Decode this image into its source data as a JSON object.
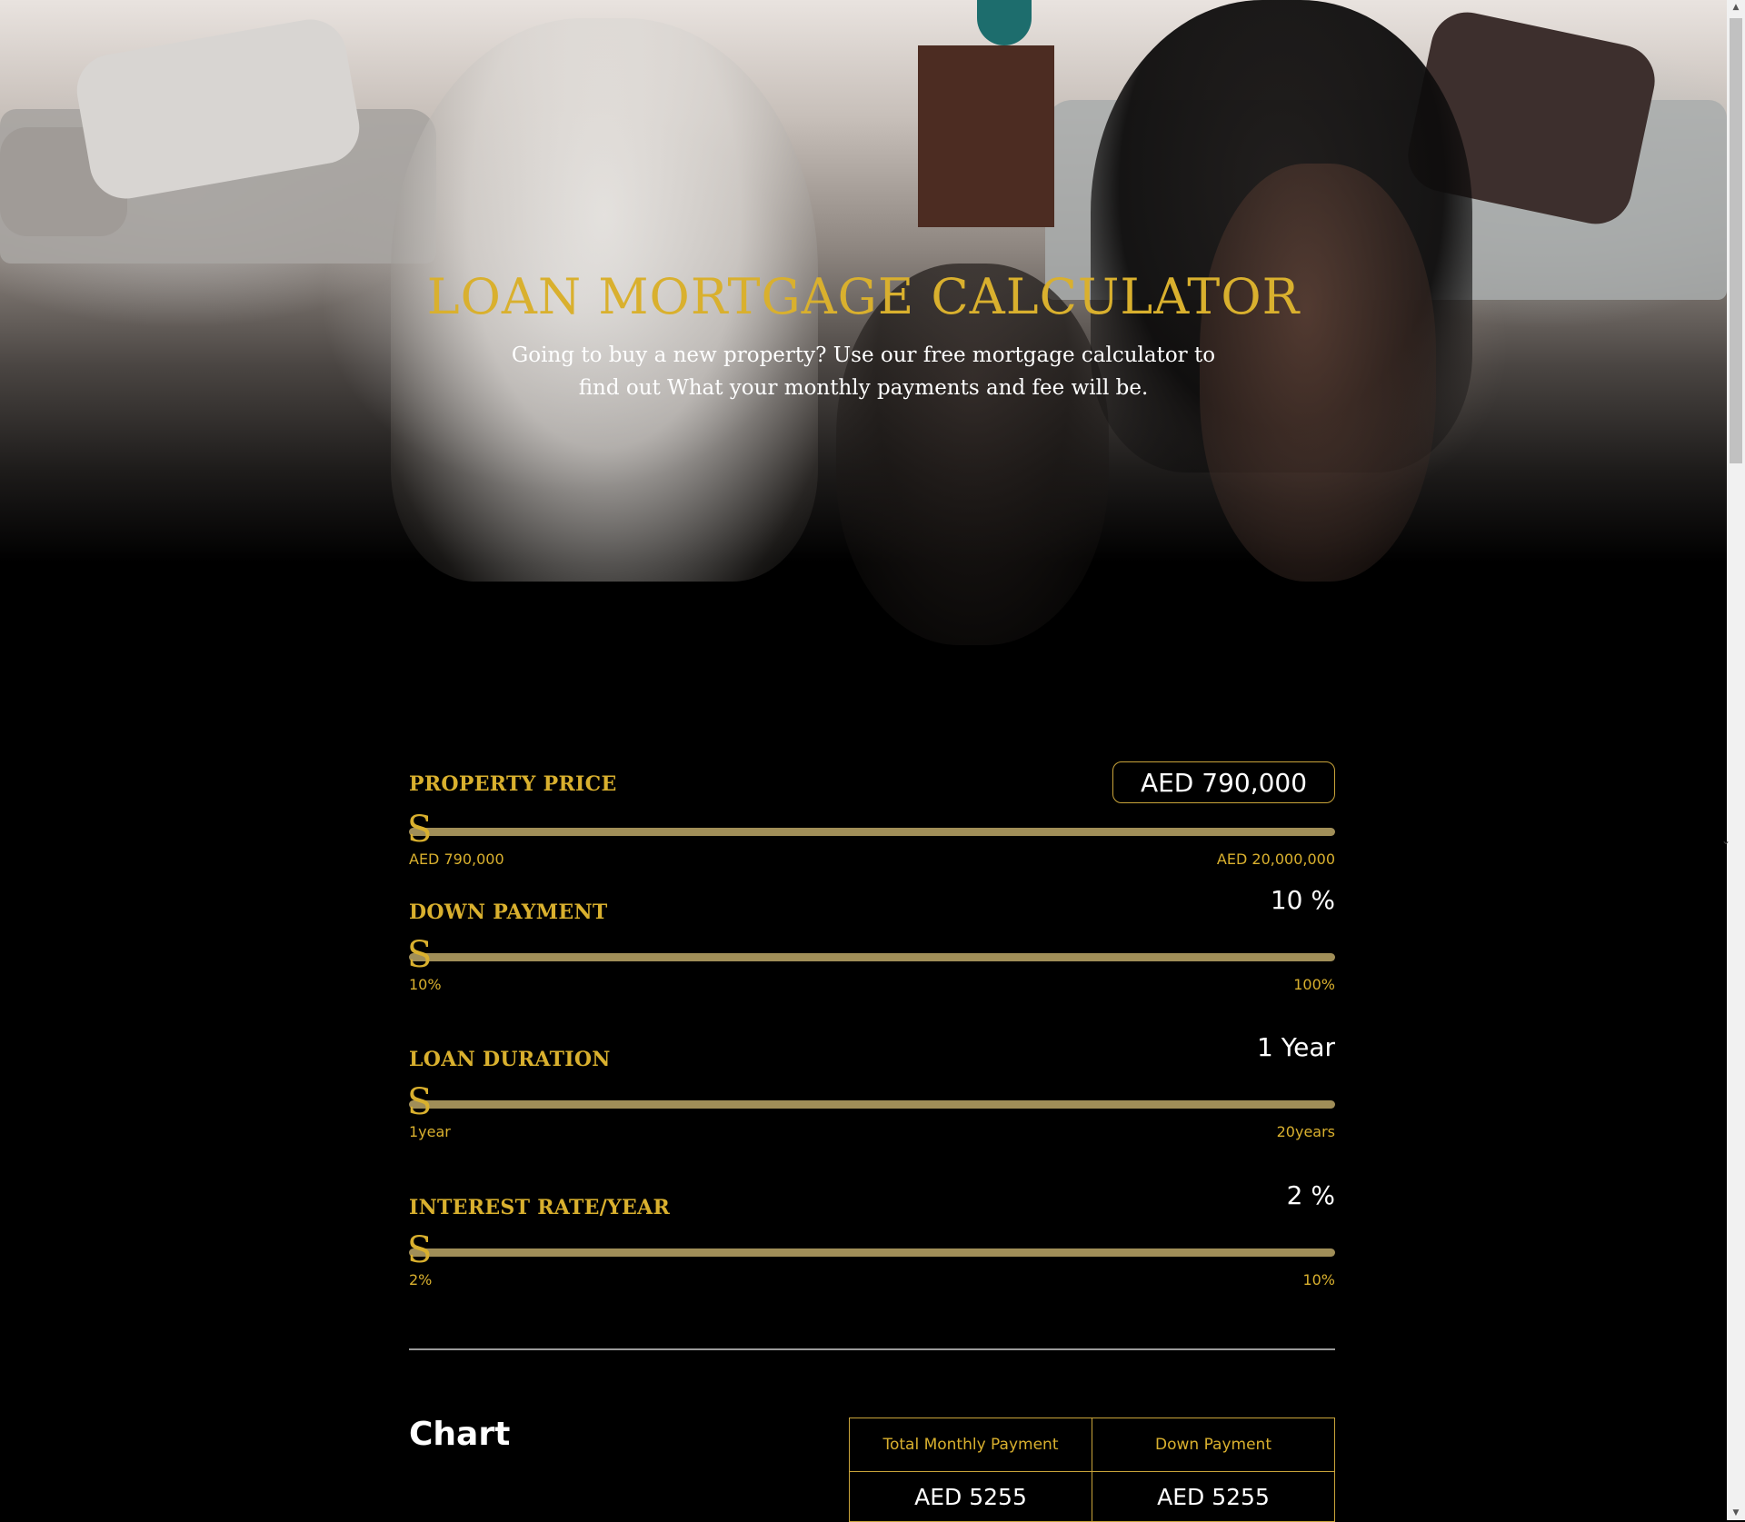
{
  "hero": {
    "title": "LOAN MORTGAGE CALCULATOR",
    "subtitle": "Going to buy a new property? Use our free mortgage calculator to find out What your monthly payments and fee will be."
  },
  "calculator": {
    "property_price": {
      "label": "PROPERTY PRICE",
      "value": "AED 790,000",
      "min": "AED 790,000",
      "max": "AED 20,000,000",
      "slider_fraction": 0
    },
    "down_payment": {
      "label": "DOWN PAYMENT",
      "value": "10 %",
      "min": "10%",
      "max": "100%",
      "slider_fraction": 0
    },
    "loan_duration": {
      "label": "LOAN DURATION",
      "value": "1 Year",
      "min": "1year",
      "max": "20years",
      "slider_fraction": 0
    },
    "interest_rate": {
      "label": "INTEREST RATE/YEAR",
      "value": "2 %",
      "min": "2%",
      "max": "10%",
      "slider_fraction": 0
    },
    "slider_thumb_glyph": "S"
  },
  "results": {
    "chart_heading": "Chart",
    "total_monthly_label": "Total Monthly Payment",
    "down_payment_label": "Down Payment",
    "total_monthly_value": "AED 5255",
    "down_payment_value": "AED 5255"
  },
  "colors": {
    "accent_gold": "#d9b02e",
    "slider_track": "#a08e58",
    "background": "#000000"
  }
}
